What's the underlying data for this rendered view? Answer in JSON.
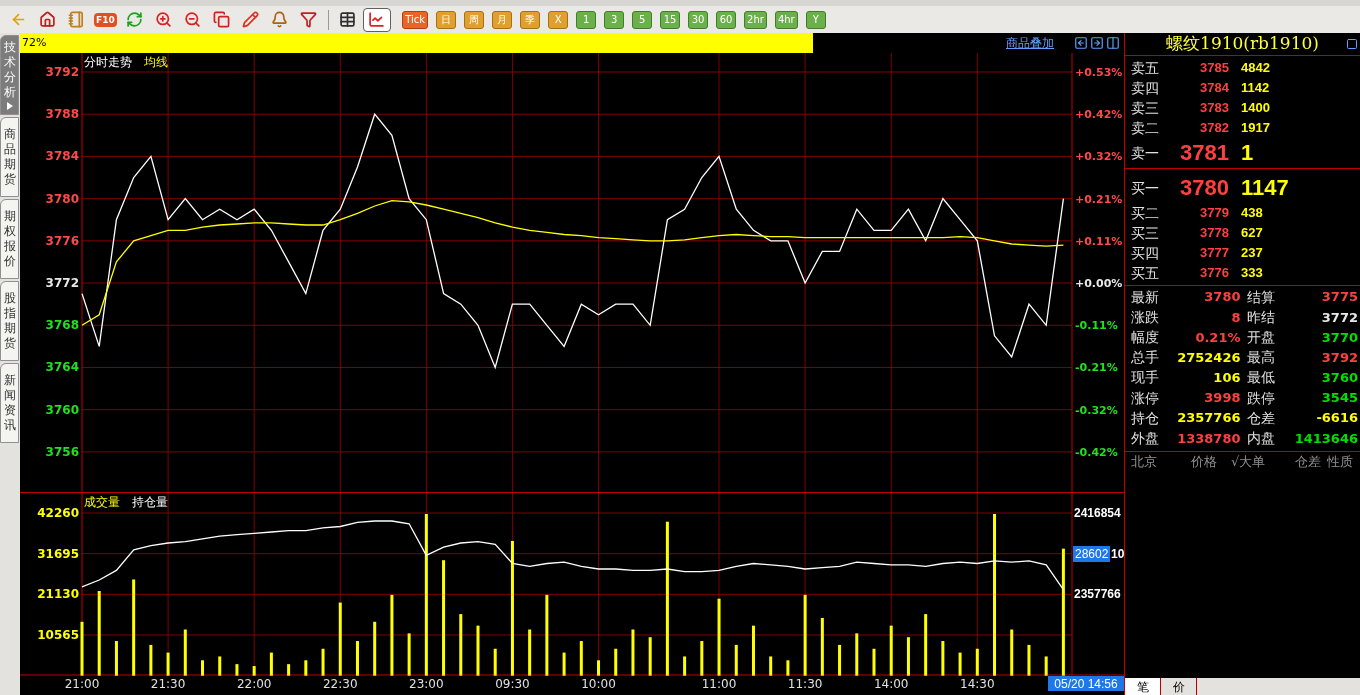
{
  "toolbar": {
    "icon_buttons": [
      {
        "kind": "back",
        "selected": false
      },
      {
        "kind": "home",
        "selected": false
      },
      {
        "kind": "notebook",
        "selected": false
      },
      {
        "kind": "f10",
        "label": "F10",
        "selected": false
      },
      {
        "kind": "refresh",
        "selected": false
      },
      {
        "kind": "zoom_in",
        "selected": false
      },
      {
        "kind": "zoom_out",
        "selected": false
      },
      {
        "kind": "windows",
        "selected": false
      },
      {
        "kind": "pencil",
        "selected": false
      },
      {
        "kind": "bell",
        "selected": false
      },
      {
        "kind": "filter",
        "selected": false
      },
      {
        "kind": "table",
        "selected": false
      },
      {
        "kind": "chart",
        "selected": true
      }
    ],
    "period_buttons": [
      {
        "label": "Tick",
        "kind": "tick"
      },
      {
        "label": "日",
        "kind": "calendar"
      },
      {
        "label": "周",
        "kind": "calendar"
      },
      {
        "label": "月",
        "kind": "calendar"
      },
      {
        "label": "季",
        "kind": "calendar"
      },
      {
        "label": "X",
        "kind": "calendar"
      },
      {
        "label": "1",
        "kind": "minute"
      },
      {
        "label": "3",
        "kind": "minute"
      },
      {
        "label": "5",
        "kind": "minute"
      },
      {
        "label": "15",
        "kind": "minute"
      },
      {
        "label": "30",
        "kind": "minute"
      },
      {
        "label": "60",
        "kind": "minute"
      },
      {
        "label": "2hr",
        "kind": "minute"
      },
      {
        "label": "4hr",
        "kind": "minute"
      },
      {
        "label": "Y",
        "kind": "minute"
      }
    ]
  },
  "side_tabs": [
    {
      "label": "技术分析",
      "selected": true
    },
    {
      "label": "商品期货",
      "selected": false
    },
    {
      "label": "期权报价",
      "selected": false
    },
    {
      "label": "股指期货",
      "selected": false
    },
    {
      "label": "新闻资讯",
      "selected": false
    }
  ],
  "chart_header": {
    "zoom": "72%",
    "overlay_link": "商品叠加"
  },
  "price_chart": {
    "reference_price": "3772",
    "right_axis_labels": [
      "+0.53%",
      "+0.42%",
      "+0.32%",
      "+0.21%",
      "+0.11%",
      "+0.00%",
      "-0.11%",
      "-0.21%",
      "-0.32%",
      "-0.42%"
    ],
    "chart_data": {
      "type": "line",
      "grid": true,
      "categories": [
        null,
        null,
        null,
        null,
        null,
        null,
        null,
        null,
        null,
        null,
        null,
        null,
        null,
        null,
        null,
        null,
        null,
        null,
        null,
        null,
        null,
        null,
        null,
        null,
        null,
        null,
        null,
        null,
        null,
        null,
        null,
        null,
        null,
        null,
        null,
        null,
        null,
        null,
        null,
        null,
        null,
        null,
        null,
        null,
        null,
        null,
        null,
        null,
        null,
        null,
        null,
        null,
        null,
        null,
        null,
        null,
        null,
        null
      ],
      "ylim": [
        3752.2,
        3793.8
      ],
      "yticks": [
        3792,
        3788,
        3784,
        3780,
        3776,
        3772,
        3768,
        3764,
        3760,
        3756
      ],
      "series": [
        {
          "name": "分时走势",
          "color": "#ffffff",
          "values": [
            3771,
            3766,
            3778,
            3782,
            3784,
            3778,
            3780,
            3778,
            3779,
            3778,
            3779,
            3777,
            3774,
            3771,
            3777,
            3779,
            3783,
            3788,
            3786,
            3780,
            3778,
            3771,
            3770,
            3768,
            3764,
            3770,
            3770,
            3768,
            3766,
            3770,
            3769,
            3770,
            3770,
            3768,
            3778,
            3779,
            3782,
            3784,
            3779,
            3777,
            3776,
            3776,
            3772,
            3775,
            3775,
            3779,
            3777,
            3777,
            3779,
            3776,
            3780,
            3778,
            3776,
            3767,
            3765,
            3770,
            3768,
            3780
          ]
        },
        {
          "name": "均线",
          "color": "#ffff00",
          "values": [
            3768,
            3769,
            3774,
            3776,
            3776.5,
            3777,
            3777,
            3777.3,
            3777.5,
            3777.6,
            3777.7,
            3777.7,
            3777.6,
            3777.5,
            3777.5,
            3778,
            3778.6,
            3779.3,
            3779.8,
            3779.7,
            3779.4,
            3779,
            3778.6,
            3778.2,
            3777.7,
            3777.3,
            3777,
            3776.8,
            3776.6,
            3776.5,
            3776.3,
            3776.2,
            3776.1,
            3776,
            3776,
            3776.1,
            3776.3,
            3776.5,
            3776.6,
            3776.5,
            3776.4,
            3776.4,
            3776.3,
            3776.3,
            3776.3,
            3776.3,
            3776.3,
            3776.3,
            3776.3,
            3776.3,
            3776.3,
            3776.4,
            3776.3,
            3776,
            3775.7,
            3775.6,
            3775.5,
            3775.6
          ]
        }
      ]
    }
  },
  "volume_chart": {
    "cursor_value": "28602",
    "cursor_remainder": "10",
    "time_cursor": "05/20 14:56",
    "chart_data": {
      "type": "bar",
      "grid": true,
      "categories": [
        "21:00",
        null,
        null,
        null,
        null,
        "21:30",
        null,
        null,
        null,
        null,
        "22:00",
        null,
        null,
        null,
        null,
        "22:30",
        null,
        null,
        null,
        null,
        "23:00",
        null,
        null,
        null,
        null,
        "09:30",
        null,
        null,
        null,
        null,
        "10:00",
        null,
        null,
        null,
        null,
        null,
        null,
        "11:00",
        null,
        null,
        null,
        null,
        "11:30",
        null,
        null,
        null,
        null,
        "14:00",
        null,
        null,
        null,
        null,
        "14:30",
        null,
        null,
        null,
        null,
        null
      ],
      "ylim": [
        0,
        47715
      ],
      "yticks": [
        42260,
        31695,
        21130,
        10565
      ],
      "series": [
        {
          "name": "成交量",
          "color": "#ffff00",
          "values": [
            14000,
            22000,
            9000,
            25000,
            8000,
            6000,
            12000,
            4000,
            5000,
            3000,
            2500,
            6000,
            3000,
            4000,
            7000,
            19000,
            9000,
            14000,
            21000,
            11000,
            42000,
            30000,
            16000,
            13000,
            7000,
            35000,
            12000,
            21000,
            6000,
            9000,
            4000,
            7000,
            12000,
            10000,
            40000,
            5000,
            9000,
            20000,
            8000,
            13000,
            5000,
            4000,
            21000,
            15000,
            8000,
            11000,
            7000,
            13000,
            10000,
            16000,
            9000,
            6000,
            7000,
            42000,
            12000,
            8000,
            5000,
            33000
          ]
        }
      ]
    },
    "open_interest": {
      "chart_data": {
        "type": "line",
        "categories": [
          null,
          null,
          null,
          null,
          null,
          null,
          null,
          null,
          null,
          null,
          null,
          null,
          null,
          null,
          null,
          null,
          null,
          null,
          null,
          null,
          null,
          null,
          null,
          null,
          null,
          null,
          null,
          null,
          null,
          null,
          null,
          null,
          null,
          null,
          null,
          null,
          null,
          null,
          null,
          null,
          null,
          null,
          null,
          null,
          null,
          null,
          null,
          null,
          null,
          null,
          null,
          null,
          null,
          null,
          null,
          null,
          null,
          null
        ],
        "ylim": [
          2298165,
          2432174
        ],
        "yticks": [
          2416854,
          2357766
        ],
        "series": [
          {
            "name": "持仓量",
            "color": "#ffffff",
            "values": [
              2363000,
              2368000,
              2375000,
              2390000,
              2393000,
              2395000,
              2396000,
              2398000,
              2400000,
              2401000,
              2402000,
              2403000,
              2404000,
              2404000,
              2406000,
              2407000,
              2410000,
              2411000,
              2411000,
              2409000,
              2386000,
              2392000,
              2395000,
              2396000,
              2394000,
              2380000,
              2378000,
              2380000,
              2381000,
              2378000,
              2376000,
              2376000,
              2375000,
              2375000,
              2376000,
              2374000,
              2374000,
              2375000,
              2378000,
              2380000,
              2379000,
              2378000,
              2376000,
              2377000,
              2378000,
              2381000,
              2380000,
              2379000,
              2379000,
              2378000,
              2380000,
              2381000,
              2380000,
              2382000,
              2381000,
              2382000,
              2379000,
              2361000
            ]
          }
        ]
      }
    }
  },
  "quote": {
    "title": "螺纹1910(rb1910)",
    "sell": [
      {
        "label": "卖五",
        "price": "3785",
        "volume": "4842",
        "kind": "level"
      },
      {
        "label": "卖四",
        "price": "3784",
        "volume": "1142",
        "kind": "level"
      },
      {
        "label": "卖三",
        "price": "3783",
        "volume": "1400",
        "kind": "level"
      },
      {
        "label": "卖二",
        "price": "3782",
        "volume": "1917",
        "kind": "level"
      },
      {
        "label": "卖一",
        "price": "3781",
        "volume": "1",
        "kind": "best"
      }
    ],
    "buy": [
      {
        "label": "买一",
        "price": "3780",
        "volume": "1147",
        "kind": "best"
      },
      {
        "label": "买二",
        "price": "3779",
        "volume": "438",
        "kind": "level"
      },
      {
        "label": "买三",
        "price": "3778",
        "volume": "627",
        "kind": "level"
      },
      {
        "label": "买四",
        "price": "3777",
        "volume": "237",
        "kind": "level"
      },
      {
        "label": "买五",
        "price": "3776",
        "volume": "333",
        "kind": "level"
      }
    ],
    "stats": [
      {
        "label": "最新",
        "value": "3780",
        "color": "#ff4040"
      },
      {
        "label": "结算",
        "value": "3775",
        "color": "#ff4040"
      },
      {
        "label": "涨跌",
        "value": "8",
        "color": "#ff4040"
      },
      {
        "label": "昨结",
        "value": "3772",
        "color": "#e8e8e8"
      },
      {
        "label": "幅度",
        "value": "0.21%",
        "color": "#ff4040"
      },
      {
        "label": "开盘",
        "value": "3770",
        "color": "#00e000"
      },
      {
        "label": "总手",
        "value": "2752426",
        "color": "#ffff00"
      },
      {
        "label": "最高",
        "value": "3792",
        "color": "#ff4040"
      },
      {
        "label": "现手",
        "value": "106",
        "color": "#ffff00"
      },
      {
        "label": "最低",
        "value": "3760",
        "color": "#00e000"
      },
      {
        "label": "涨停",
        "value": "3998",
        "color": "#ff4040"
      },
      {
        "label": "跌停",
        "value": "3545",
        "color": "#00e000"
      },
      {
        "label": "持仓",
        "value": "2357766",
        "color": "#ffff00"
      },
      {
        "label": "仓差",
        "value": "-6616",
        "color": "#ffff00"
      },
      {
        "label": "外盘",
        "value": "1338780",
        "color": "#ff4040"
      },
      {
        "label": "内盘",
        "value": "1413646",
        "color": "#00e000"
      }
    ],
    "trade_columns": [
      "北京",
      "价格",
      "√大单",
      "仓差",
      "性质"
    ],
    "bottom_tabs": [
      {
        "label": "笔",
        "selected": true
      },
      {
        "label": "价",
        "selected": false
      }
    ]
  }
}
